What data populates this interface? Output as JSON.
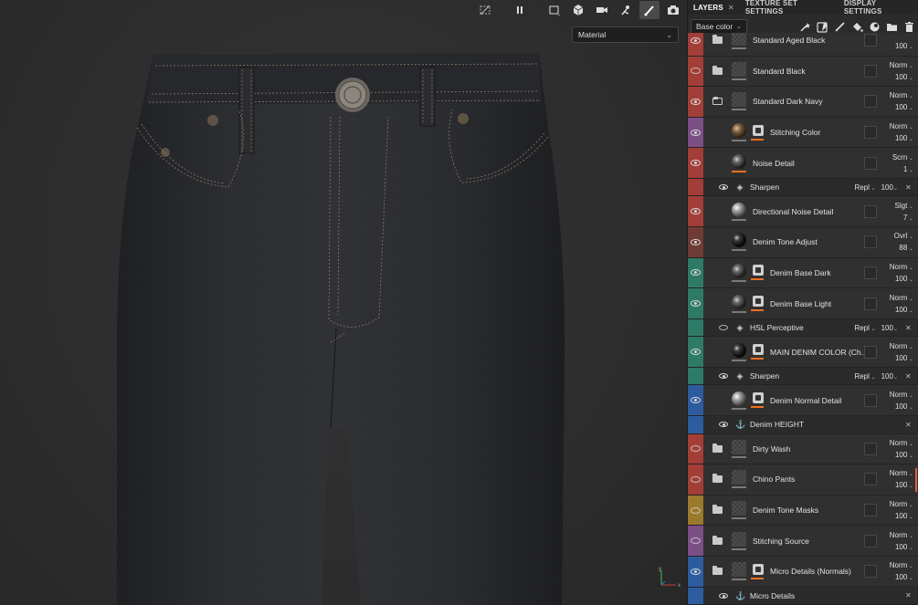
{
  "viewport": {
    "material_select": "Material",
    "toolbar_icons": [
      "hide-icon",
      "pause-icon",
      "frame-icon",
      "cube-icon",
      "camera-video-icon",
      "rig-icon",
      "paint-brush-icon",
      "screenshot-camera-icon"
    ]
  },
  "panel": {
    "tabs": [
      {
        "label": "LAYERS",
        "active": true,
        "closable": true
      },
      {
        "label": "TEXTURE SET SETTINGS",
        "active": false,
        "closable": false
      },
      {
        "label": "DISPLAY SETTINGS",
        "active": false,
        "closable": false
      }
    ],
    "channel": "Base color",
    "tool_icons": [
      "add-fill-wand-icon",
      "add-mask-icon",
      "paint-brush-icon",
      "fill-bucket-icon",
      "add-effect-icon",
      "folder-icon",
      "trash-icon"
    ],
    "layers": [
      {
        "type": "row",
        "name": "Standard Aged Black",
        "color": "#a23e37",
        "visible": true,
        "kind": "folder",
        "blend": "",
        "opacity": "100",
        "partial": true
      },
      {
        "type": "row",
        "name": "Standard Black",
        "color": "#a23e37",
        "visible": false,
        "kind": "folder",
        "blend": "Norm",
        "opacity": "100"
      },
      {
        "type": "row",
        "name": "Standard Dark Navy",
        "color": "#a23e37",
        "visible": true,
        "kind": "folder-open",
        "blend": "Norm",
        "opacity": "100"
      },
      {
        "type": "row",
        "name": "Stitching Color",
        "color": "#7c4e86",
        "visible": true,
        "kind": "fill-mask",
        "sphere": "brown",
        "blend": "Norm",
        "opacity": "100"
      },
      {
        "type": "row",
        "name": "Noise Detail",
        "color": "#a23e37",
        "visible": true,
        "kind": "fill",
        "sphere": "dark",
        "barOrange": true,
        "blend": "Scrn",
        "opacity": "1"
      },
      {
        "type": "sub",
        "name": "Sharpen",
        "color": "#a23e37",
        "icon": "filter",
        "blend": "Repl",
        "opacity": "100"
      },
      {
        "type": "row",
        "name": "Directional Noise Detail",
        "color": "#a23e37",
        "visible": true,
        "kind": "fill",
        "sphere": "light",
        "blend": "Slgt",
        "opacity": "7"
      },
      {
        "type": "row",
        "name": "Denim Tone Adjust",
        "color": "#6e3b35",
        "visible": true,
        "kind": "fill",
        "sphere": "black",
        "blend": "Ovrl",
        "opacity": "88"
      },
      {
        "type": "row",
        "name": "Denim Base Dark",
        "color": "#2f7a66",
        "visible": true,
        "kind": "fill-mask",
        "sphere": "dark",
        "blend": "Norm",
        "opacity": "100"
      },
      {
        "type": "row",
        "name": "Denim Base Light",
        "color": "#2f7a66",
        "visible": true,
        "kind": "fill-mask",
        "sphere": "dark",
        "barOrange": true,
        "blend": "Norm",
        "opacity": "100"
      },
      {
        "type": "sub",
        "name": "HSL Perceptive",
        "color": "#2f7a66",
        "icon": "filter",
        "blend": "Repl",
        "opacity": "100",
        "eyeOff": true
      },
      {
        "type": "row",
        "name": "MAIN DENIM COLOR (Ch...",
        "color": "#2f7a66",
        "visible": true,
        "kind": "fill-mask",
        "sphere": "black",
        "barOrange": true,
        "blend": "Norm",
        "opacity": "100"
      },
      {
        "type": "sub",
        "name": "Sharpen",
        "color": "#2f7a66",
        "icon": "filter",
        "blend": "Repl",
        "opacity": "100"
      },
      {
        "type": "row",
        "name": "Denim Normal Detail",
        "color": "#2c5c9e",
        "visible": true,
        "kind": "fill-mask",
        "sphere": "light",
        "barOrange": true,
        "blend": "Norm",
        "opacity": "100"
      },
      {
        "type": "sub",
        "name": "Denim HEIGHT",
        "color": "#2c5c9e",
        "icon": "anchor",
        "blend": "",
        "opacity": ""
      },
      {
        "type": "row",
        "name": "Dirty Wash",
        "color": "#a23e37",
        "visible": false,
        "kind": "folder",
        "blend": "Norm",
        "opacity": "100"
      },
      {
        "type": "row",
        "name": "Chino Pants",
        "color": "#a23e37",
        "visible": false,
        "kind": "folder",
        "blend": "Norm",
        "opacity": "100",
        "scrollMark": true
      },
      {
        "type": "row",
        "name": "Denim Tone Masks",
        "color": "#9a7a2c",
        "visible": false,
        "kind": "folder",
        "blend": "Norm",
        "opacity": "100"
      },
      {
        "type": "row",
        "name": "Stitching Source",
        "color": "#7c4e86",
        "visible": false,
        "kind": "folder",
        "blend": "Norm",
        "opacity": "100"
      },
      {
        "type": "row",
        "name": "Micro Details (Normals)",
        "color": "#2c5c9e",
        "visible": true,
        "kind": "folder-mask",
        "barOrange": true,
        "blend": "Norm",
        "opacity": "100"
      },
      {
        "type": "sub",
        "name": "Micro Details",
        "color": "#2c5c9e",
        "icon": "anchor",
        "blend": "",
        "opacity": ""
      }
    ]
  }
}
